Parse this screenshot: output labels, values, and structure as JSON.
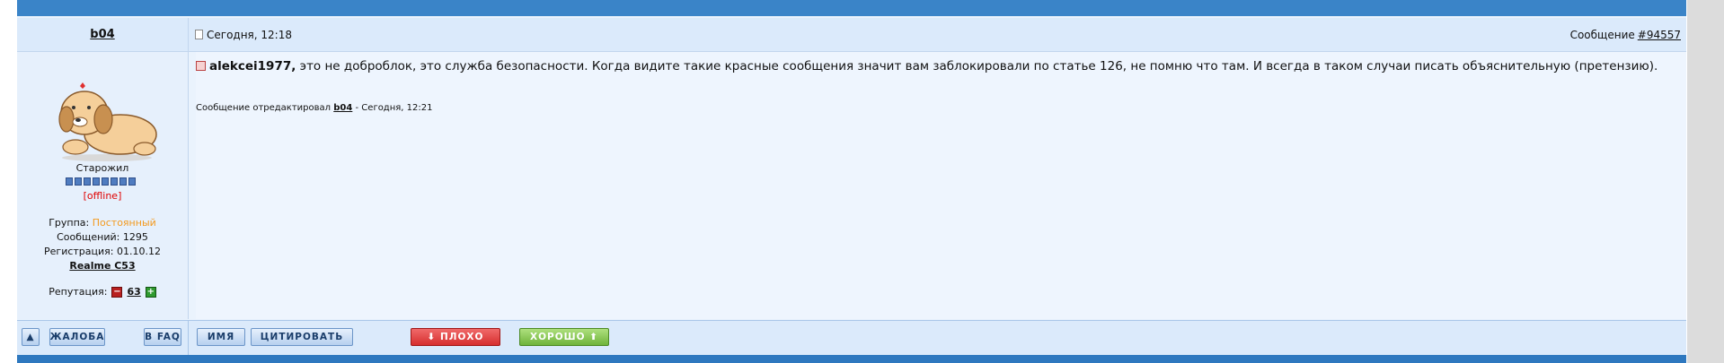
{
  "post": {
    "author": "b04",
    "date": "Сегодня, 12:18",
    "message_label": "Сообщение",
    "message_number": "#94557"
  },
  "user": {
    "rank": "Старожил",
    "status": "[offline]",
    "group_label": "Группа:",
    "group_value": "Постоянный",
    "posts": "Сообщений: 1295",
    "registered": "Регистрация: 01.10.12",
    "device": "Realme C53",
    "reputation_label": "Репутация:",
    "reputation_value": "63"
  },
  "message": {
    "addressee": "alekcei1977,",
    "text": "это не доброблок, это служба безопасности. Когда видите такие красные сообщения значит вам заблокировали по статье 126, не помню что там. И всегда в таком случаи писать объяснительную (претензию).",
    "edited_prefix": "Сообщение отредактировал",
    "edited_by": "b04",
    "edited_suffix": "- Сегодня, 12:21"
  },
  "buttons": {
    "up": "▲",
    "complaint": "ЖАЛОБА",
    "faq": "В FAQ",
    "name": "ИМЯ",
    "quote": "ЦИТИРОВАТЬ",
    "bad": "⬇ ПЛОХО",
    "good": "ХОРОШО ⬆"
  },
  "colors": {
    "accent_bar": "#3a84c8",
    "offline": "#e00000",
    "group": "#f39a1f",
    "bad_button": "#d62e2e",
    "good_button": "#6fb33a"
  }
}
